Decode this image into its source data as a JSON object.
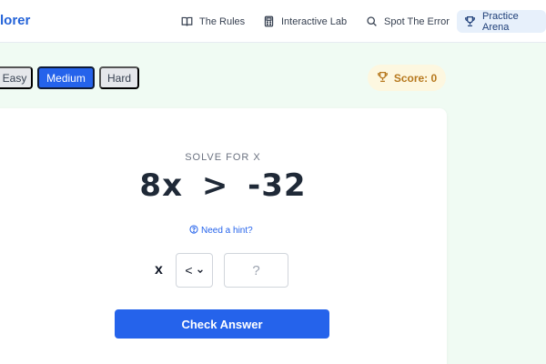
{
  "header": {
    "brand": "lorer",
    "nav": [
      {
        "label": "The Rules",
        "icon": "book-icon"
      },
      {
        "label": "Interactive Lab",
        "icon": "calculator-icon"
      },
      {
        "label": "Spot The Error",
        "icon": "search-icon"
      },
      {
        "label": "Practice Arena",
        "icon": "trophy-icon",
        "active": true
      }
    ]
  },
  "difficulty": {
    "easy": "Easy",
    "medium": "Medium",
    "hard": "Hard",
    "selected": "Medium"
  },
  "score": {
    "label": "Score: 0"
  },
  "problem": {
    "instruction": "SOLVE FOR X",
    "equation": "8x > -32",
    "hint": "Need a hint?",
    "variable": "x",
    "operator": "<",
    "answer_placeholder": "?",
    "check_button": "Check Answer"
  },
  "colors": {
    "accent": "#2563eb",
    "background": "#f0fbf3",
    "score": "#b7791f"
  }
}
